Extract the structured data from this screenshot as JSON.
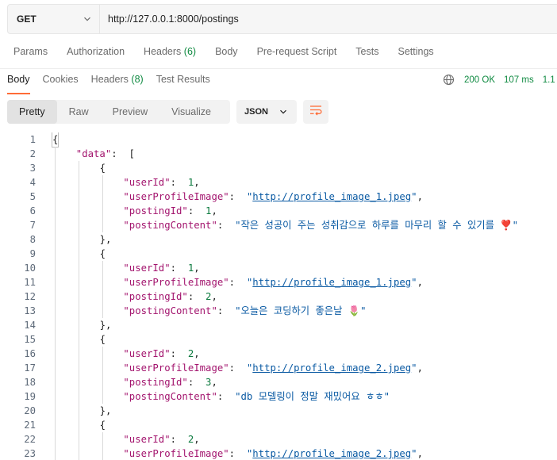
{
  "request": {
    "method": "GET",
    "url": "http://127.0.0.1:8000/postings"
  },
  "request_tabs": [
    {
      "label": "Params"
    },
    {
      "label": "Authorization"
    },
    {
      "label": "Headers",
      "count": "(6)"
    },
    {
      "label": "Body"
    },
    {
      "label": "Pre-request Script"
    },
    {
      "label": "Tests"
    },
    {
      "label": "Settings"
    }
  ],
  "response_tabs": [
    {
      "label": "Body"
    },
    {
      "label": "Cookies"
    },
    {
      "label": "Headers",
      "count": "(8)"
    },
    {
      "label": "Test Results"
    }
  ],
  "status": {
    "code": "200 OK",
    "time": "107 ms",
    "size": "1.1"
  },
  "view_modes": [
    "Pretty",
    "Raw",
    "Preview",
    "Visualize"
  ],
  "format": "JSON",
  "colors": {
    "accent": "#ff6c37",
    "status_green": "#0f8a41",
    "json_key": "#a3156e",
    "json_string": "#0a5aa3",
    "json_number": "#0b7a3e"
  },
  "code_lines": [
    {
      "n": "1",
      "text": "{"
    },
    {
      "n": "2",
      "text": "\"data\": ["
    },
    {
      "n": "3",
      "text": "{"
    },
    {
      "n": "4",
      "text": "\"userId\": 1,"
    },
    {
      "n": "5",
      "text": "\"userProfileImage\": \"http://profile_image_1.jpeg\","
    },
    {
      "n": "6",
      "text": "\"postingId\": 1,"
    },
    {
      "n": "7",
      "text": "\"postingContent\": \"작은 성공이 주는 성취감으로 하루를 마무리 할 수 있기를 ❣️\""
    },
    {
      "n": "8",
      "text": "},"
    },
    {
      "n": "9",
      "text": "{"
    },
    {
      "n": "10",
      "text": "\"userId\": 1,"
    },
    {
      "n": "11",
      "text": "\"userProfileImage\": \"http://profile_image_1.jpeg\","
    },
    {
      "n": "12",
      "text": "\"postingId\": 2,"
    },
    {
      "n": "13",
      "text": "\"postingContent\": \"오늘은 코딩하기 좋은날 🌷\""
    },
    {
      "n": "14",
      "text": "},"
    },
    {
      "n": "15",
      "text": "{"
    },
    {
      "n": "16",
      "text": "\"userId\": 2,"
    },
    {
      "n": "17",
      "text": "\"userProfileImage\": \"http://profile_image_2.jpeg\","
    },
    {
      "n": "18",
      "text": "\"postingId\": 3,"
    },
    {
      "n": "19",
      "text": "\"postingContent\": \"db 모델링이 정말 재밌어요 ㅎㅎ\""
    },
    {
      "n": "20",
      "text": "},"
    },
    {
      "n": "21",
      "text": "{"
    },
    {
      "n": "22",
      "text": "\"userId\": 2,"
    },
    {
      "n": "23",
      "text": "\"userProfileImage\": \"http://profile_image_2.jpeg\","
    }
  ]
}
